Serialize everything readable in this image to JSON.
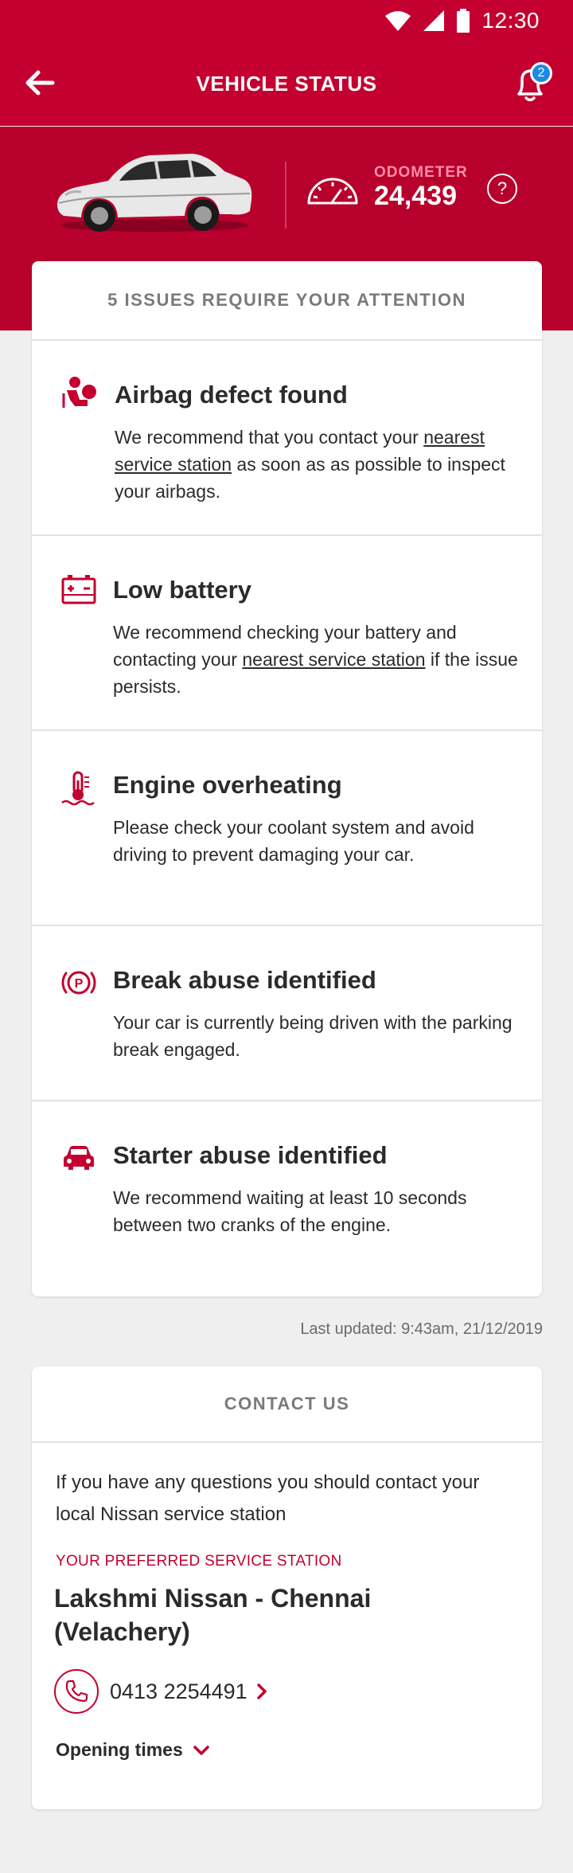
{
  "status_bar": {
    "time": "12:30",
    "icons": [
      "wifi-icon",
      "cell-signal-icon",
      "battery-icon"
    ]
  },
  "app_bar": {
    "title": "VEHICLE STATUS",
    "notification_count": "2"
  },
  "vehicle": {
    "odometer_label": "ODOMETER",
    "odometer_value": "24,439",
    "help_symbol": "?"
  },
  "issues": {
    "header": "5 ISSUES REQUIRE YOUR ATTENTION",
    "items": [
      {
        "icon": "airbag-icon",
        "title": "Airbag defect found",
        "d1": "We recommend that you contact your ",
        "link": "nearest service station",
        "d2": " as soon as as possible to inspect your airbags."
      },
      {
        "icon": "battery-warning-icon",
        "title": "Low battery",
        "d1": "We recommend checking your battery and contacting your ",
        "link": "nearest service station",
        "d2": " if the issue persists."
      },
      {
        "icon": "thermometer-icon",
        "title": "Engine overheating",
        "d1": "Please check your coolant system and avoid driving to prevent damaging your car.",
        "link": "",
        "d2": ""
      },
      {
        "icon": "parking-brake-icon",
        "title": "Break abuse identified",
        "d1": "Your car is currently being driven with the parking break engaged.",
        "link": "",
        "d2": ""
      },
      {
        "icon": "car-front-icon",
        "title": "Starter abuse identified",
        "d1": "We recommend waiting at least 10 seconds between two cranks of the engine.",
        "link": "",
        "d2": ""
      }
    ]
  },
  "last_updated": "Last updated: 9:43am, 21/12/2019",
  "contact": {
    "header": "CONTACT US",
    "text": "If you have any questions you should contact your local Nissan service station",
    "preferred_label": "YOUR PREFERRED SERVICE STATION",
    "station_name": "Lakshmi Nissan - Chennai (Velachery)",
    "phone": "0413 2254491",
    "opening_times": "Opening times"
  },
  "colors": {
    "brand_red": "#c3002f",
    "hero_red": "#b8002c",
    "background": "#efefef",
    "badge_blue": "#1e88e5"
  }
}
